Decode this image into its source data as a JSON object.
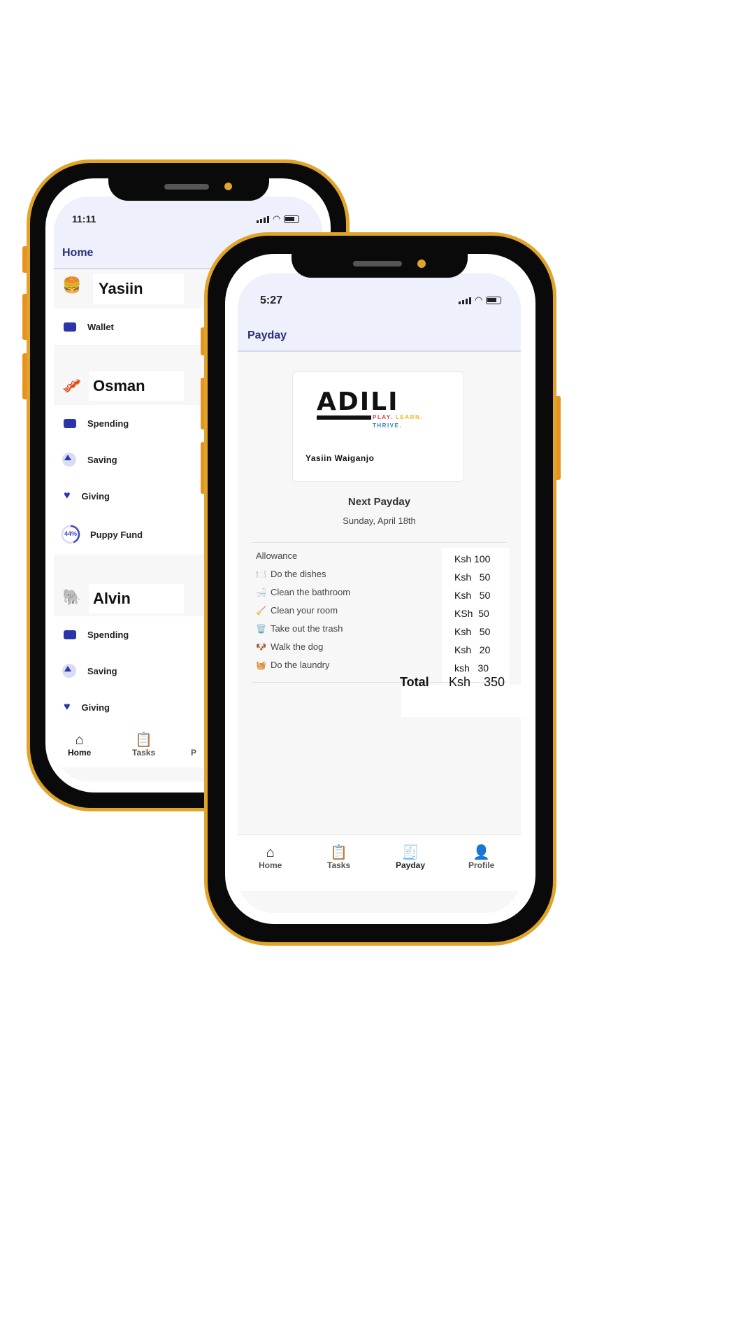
{
  "back_phone": {
    "status_time": "11:11",
    "header_title": "Home",
    "children": [
      {
        "name": "Yasiin",
        "emoji": "🍔",
        "rows": [
          {
            "label": "Wallet",
            "icon": "wallet-icon"
          }
        ]
      },
      {
        "name": "Osman",
        "emoji": "🥓",
        "rows": [
          {
            "label": "Spending",
            "icon": "card-icon"
          },
          {
            "label": "Saving",
            "icon": "piggy-icon"
          },
          {
            "label": "Giving",
            "icon": "heart-icon"
          },
          {
            "label": "Puppy Fund",
            "icon": "progress-ring-icon",
            "progress_label": "44%",
            "progress": 0.44
          }
        ]
      },
      {
        "name": "Alvin",
        "emoji": "🐘",
        "rows": [
          {
            "label": "Spending",
            "icon": "card-icon"
          },
          {
            "label": "Saving",
            "icon": "piggy-icon"
          },
          {
            "label": "Giving",
            "icon": "heart-icon"
          }
        ]
      }
    ],
    "nav": [
      {
        "label": "Home",
        "icon": "house-icon",
        "active": true
      },
      {
        "label": "Tasks",
        "icon": "clipboard-icon"
      },
      {
        "label": "P",
        "icon": "payday-icon"
      }
    ]
  },
  "front_phone": {
    "status_time": "5:27",
    "header_title": "Payday",
    "logo": {
      "wordmark": "ADILI",
      "tagline_play": "PLAY.",
      "tagline_learn": "LEARN.",
      "tagline_thrive": "THRIVE."
    },
    "card_name": "Yasiin Waiganjo",
    "next_payday_title": "Next Payday",
    "next_payday_date": "Sunday, April 18th",
    "items": [
      {
        "icon": "",
        "label": "Allowance",
        "amount": "Ksh 100"
      },
      {
        "icon": "🍽️",
        "label": "Do the dishes",
        "amount": "Ksh   50"
      },
      {
        "icon": "🛁",
        "label": "Clean the bathroom",
        "amount": "Ksh   50"
      },
      {
        "icon": "🧹",
        "label": "Clean your room",
        "amount": "KSh  50"
      },
      {
        "icon": "🗑️",
        "label": "Take out the trash",
        "amount": "Ksh   50"
      },
      {
        "icon": "🐶",
        "label": "Walk the dog",
        "amount": "Ksh   20"
      },
      {
        "icon": "🧺",
        "label": "Do the laundry",
        "amount": "ksh   30"
      }
    ],
    "total_label": "Total",
    "total_currency": "Ksh",
    "total_value": "350",
    "nav": [
      {
        "label": "Home",
        "icon": "house-icon"
      },
      {
        "label": "Tasks",
        "icon": "clipboard-icon"
      },
      {
        "label": "Payday",
        "icon": "payday-icon",
        "active": true
      },
      {
        "label": "Profile",
        "icon": "person-icon"
      }
    ]
  },
  "colors": {
    "frame_gold": "#e0a42a",
    "side_button_orange": "#e8921f",
    "brand_navy": "#2a2f7d",
    "accent_blue": "#2b34a8",
    "tagline_red": "#d63b3b",
    "tagline_yellow": "#e8b21f",
    "tagline_blue": "#2a7fc1"
  }
}
